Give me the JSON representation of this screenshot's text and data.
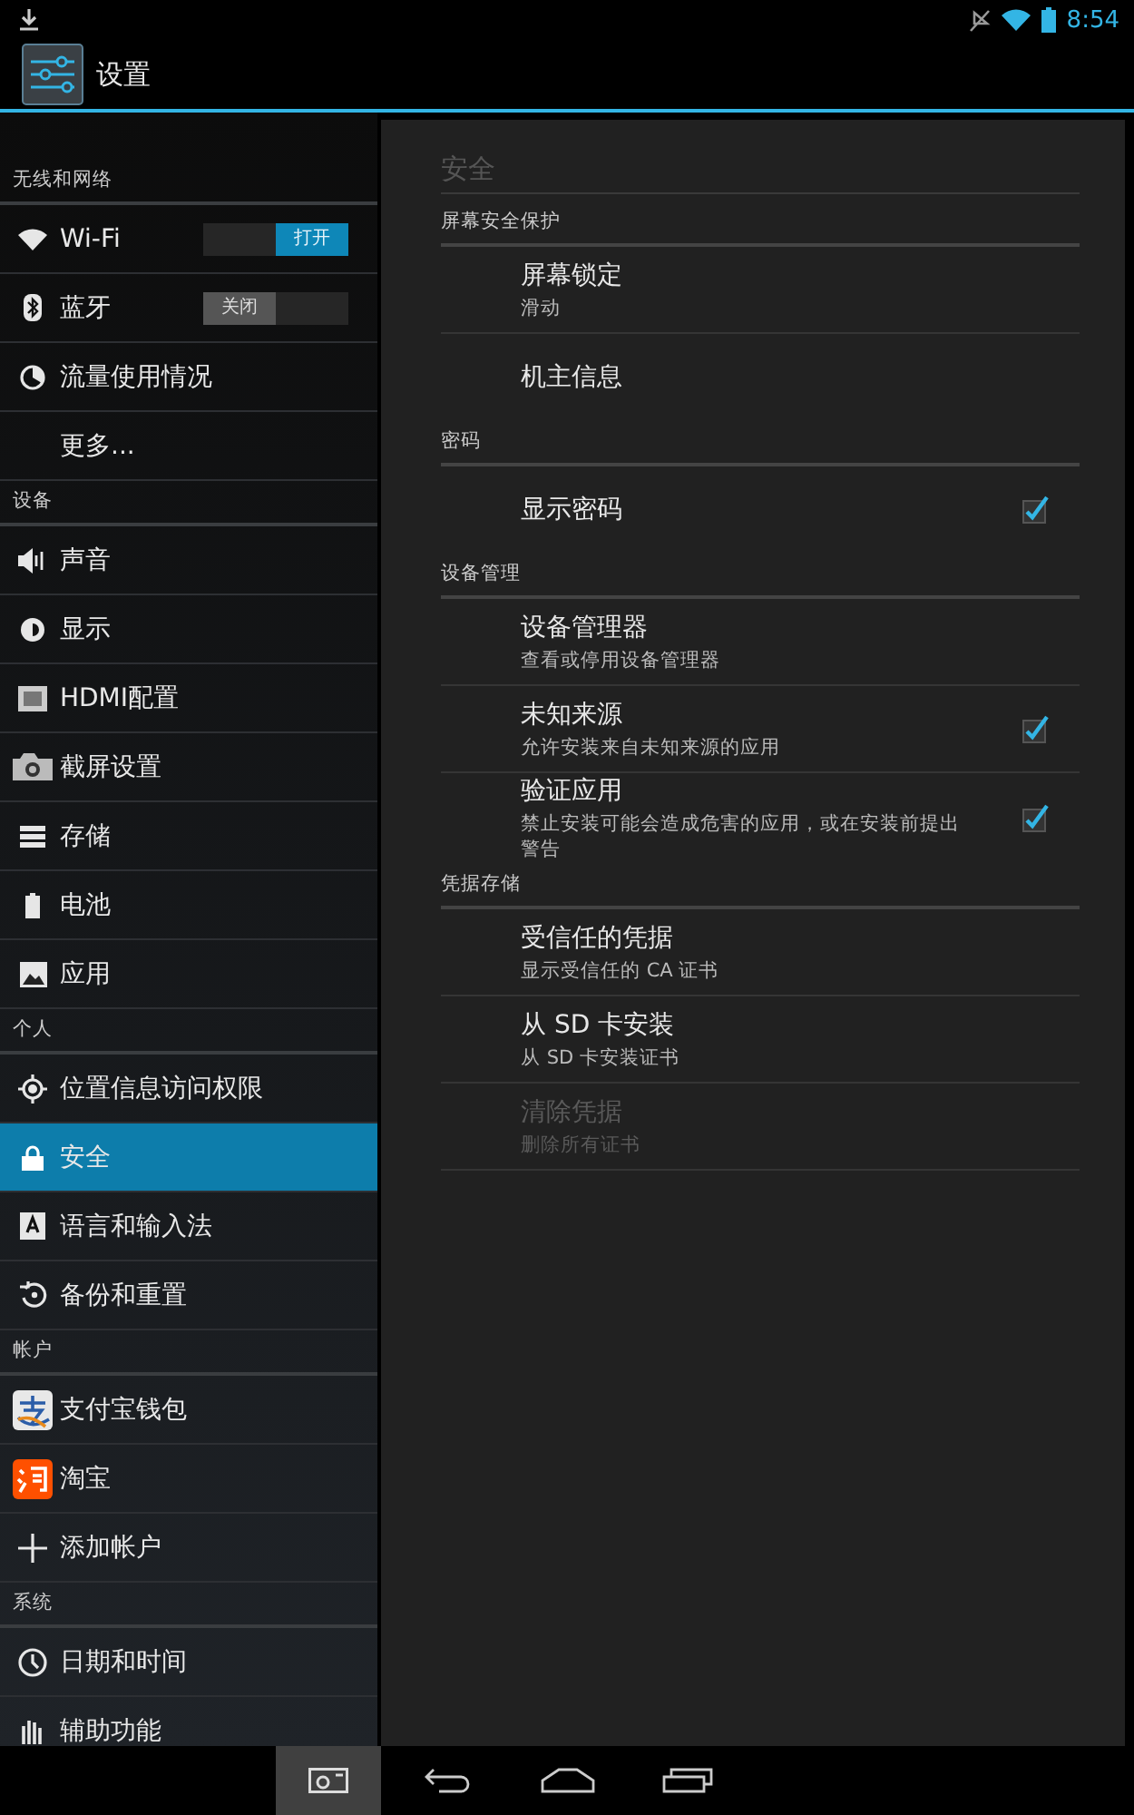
{
  "status_bar": {
    "time": "8:54"
  },
  "action_bar": {
    "title": "设置"
  },
  "sidebar": {
    "sections": [
      {
        "header": "无线和网络",
        "items": [
          {
            "label": "Wi-Fi",
            "selected": false,
            "toggle": {
              "label": "打开",
              "on": true
            }
          },
          {
            "label": "蓝牙",
            "selected": false,
            "toggle": {
              "label": "关闭",
              "on": false
            }
          },
          {
            "label": "流量使用情况",
            "selected": false
          },
          {
            "label": "更多...",
            "selected": false
          }
        ]
      },
      {
        "header": "设备",
        "items": [
          {
            "label": "声音",
            "selected": false
          },
          {
            "label": "显示",
            "selected": false
          },
          {
            "label": "HDMI配置",
            "selected": false
          },
          {
            "label": "截屏设置",
            "selected": false
          },
          {
            "label": "存储",
            "selected": false
          },
          {
            "label": "电池",
            "selected": false
          },
          {
            "label": "应用",
            "selected": false
          }
        ]
      },
      {
        "header": "个人",
        "items": [
          {
            "label": "位置信息访问权限",
            "selected": false
          },
          {
            "label": "安全",
            "selected": true
          },
          {
            "label": "语言和输入法",
            "selected": false
          },
          {
            "label": "备份和重置",
            "selected": false
          }
        ]
      },
      {
        "header": "帐户",
        "items": [
          {
            "label": "支付宝钱包",
            "selected": false
          },
          {
            "label": "淘宝",
            "selected": false
          },
          {
            "label": "添加帐户",
            "selected": false
          }
        ]
      },
      {
        "header": "系统",
        "items": [
          {
            "label": "日期和时间",
            "selected": false
          },
          {
            "label": "辅助功能",
            "selected": false
          }
        ]
      }
    ]
  },
  "detail": {
    "title": "安全",
    "categories": [
      {
        "header": "屏幕安全保护",
        "items": [
          {
            "title": "屏幕锁定",
            "summary": "滑动",
            "disabled": false
          },
          {
            "title": "机主信息",
            "disabled": false
          }
        ]
      },
      {
        "header": "密码",
        "items": [
          {
            "title": "显示密码",
            "disabled": false,
            "checked": true
          }
        ]
      },
      {
        "header": "设备管理",
        "items": [
          {
            "title": "设备管理器",
            "summary": "查看或停用设备管理器",
            "disabled": false
          },
          {
            "title": "未知来源",
            "summary": "允许安装来自未知来源的应用",
            "disabled": false,
            "checked": true
          },
          {
            "title": "验证应用",
            "summary": "禁止安装可能会造成危害的应用，或在安装前提出警告",
            "disabled": false,
            "checked": true
          }
        ]
      },
      {
        "header": "凭据存储",
        "items": [
          {
            "title": "受信任的凭据",
            "summary": "显示受信任的 CA 证书",
            "disabled": false
          },
          {
            "title": "从 SD 卡安装",
            "summary": "从 SD 卡安装证书",
            "disabled": false
          },
          {
            "title": "清除凭据",
            "summary": "删除所有证书",
            "disabled": true
          }
        ]
      }
    ]
  }
}
